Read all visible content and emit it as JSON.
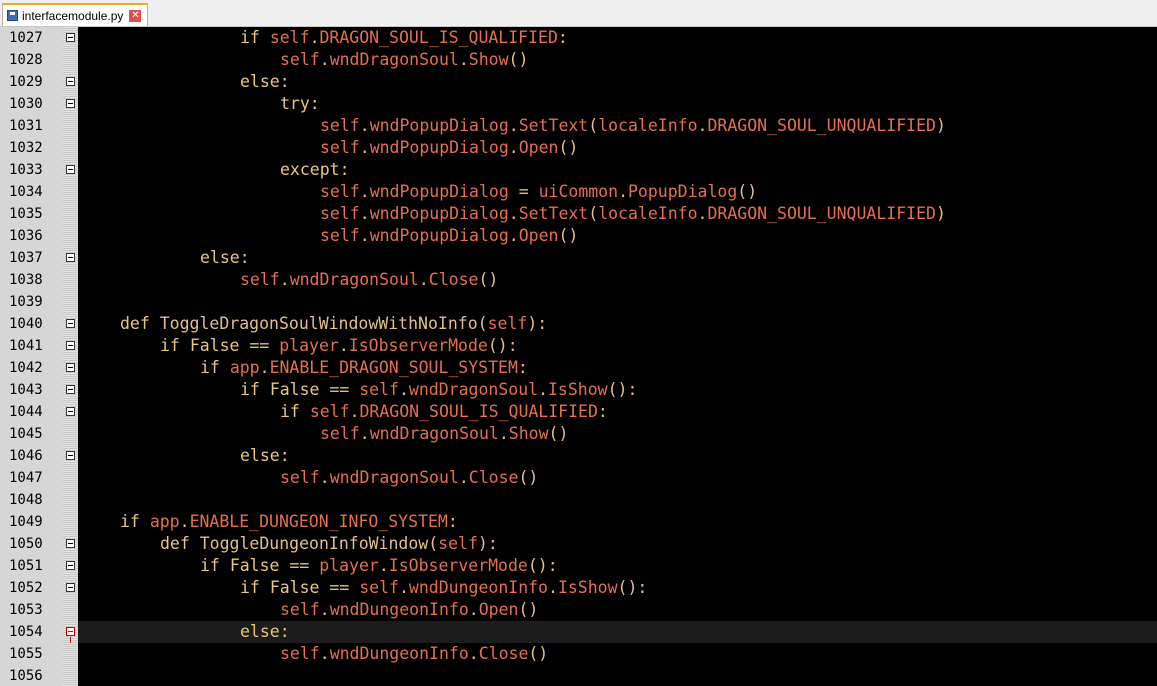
{
  "tab": {
    "title": "interfacemodule.py",
    "close_glyph": "✕"
  },
  "colors": {
    "background": "#000000",
    "gutter": "#d6d6d6",
    "keyword": "#e8c97a",
    "identifier": "#e56f4f",
    "tab_accent": "#f5a623"
  },
  "editor": {
    "current_line": "1054",
    "lines": [
      {
        "n": "1027",
        "fold": "box",
        "indent": 4,
        "tokens": [
          [
            "kw",
            "if "
          ],
          [
            "self",
            "self"
          ],
          [
            "punct",
            "."
          ],
          [
            "attr",
            "DRAGON_SOUL_IS_QUALIFIED"
          ],
          [
            "punct",
            ":"
          ]
        ]
      },
      {
        "n": "1028",
        "fold": "",
        "indent": 5,
        "tokens": [
          [
            "self",
            "self"
          ],
          [
            "punct",
            "."
          ],
          [
            "attr",
            "wndDragonSoul"
          ],
          [
            "punct",
            "."
          ],
          [
            "attr",
            "Show"
          ],
          [
            "punct",
            "()"
          ]
        ]
      },
      {
        "n": "1029",
        "fold": "box",
        "indent": 4,
        "tokens": [
          [
            "kw",
            "else:"
          ]
        ]
      },
      {
        "n": "1030",
        "fold": "box",
        "indent": 5,
        "tokens": [
          [
            "kw",
            "try:"
          ]
        ]
      },
      {
        "n": "1031",
        "fold": "",
        "indent": 6,
        "tokens": [
          [
            "self",
            "self"
          ],
          [
            "punct",
            "."
          ],
          [
            "attr",
            "wndPopupDialog"
          ],
          [
            "punct",
            "."
          ],
          [
            "attr",
            "SetText"
          ],
          [
            "punct",
            "("
          ],
          [
            "attr",
            "localeInfo"
          ],
          [
            "punct",
            "."
          ],
          [
            "attr",
            "DRAGON_SOUL_UNQUALIFIED"
          ],
          [
            "punct",
            ")"
          ]
        ]
      },
      {
        "n": "1032",
        "fold": "",
        "indent": 6,
        "tokens": [
          [
            "self",
            "self"
          ],
          [
            "punct",
            "."
          ],
          [
            "attr",
            "wndPopupDialog"
          ],
          [
            "punct",
            "."
          ],
          [
            "attr",
            "Open"
          ],
          [
            "punct",
            "()"
          ]
        ]
      },
      {
        "n": "1033",
        "fold": "box",
        "indent": 5,
        "tokens": [
          [
            "kw",
            "except:"
          ]
        ]
      },
      {
        "n": "1034",
        "fold": "",
        "indent": 6,
        "tokens": [
          [
            "self",
            "self"
          ],
          [
            "punct",
            "."
          ],
          [
            "attr",
            "wndPopupDialog"
          ],
          [
            "punct",
            " = "
          ],
          [
            "attr",
            "uiCommon"
          ],
          [
            "punct",
            "."
          ],
          [
            "attr",
            "PopupDialog"
          ],
          [
            "punct",
            "()"
          ]
        ]
      },
      {
        "n": "1035",
        "fold": "",
        "indent": 6,
        "tokens": [
          [
            "self",
            "self"
          ],
          [
            "punct",
            "."
          ],
          [
            "attr",
            "wndPopupDialog"
          ],
          [
            "punct",
            "."
          ],
          [
            "attr",
            "SetText"
          ],
          [
            "punct",
            "("
          ],
          [
            "attr",
            "localeInfo"
          ],
          [
            "punct",
            "."
          ],
          [
            "attr",
            "DRAGON_SOUL_UNQUALIFIED"
          ],
          [
            "punct",
            ")"
          ]
        ]
      },
      {
        "n": "1036",
        "fold": "",
        "indent": 6,
        "tokens": [
          [
            "self",
            "self"
          ],
          [
            "punct",
            "."
          ],
          [
            "attr",
            "wndPopupDialog"
          ],
          [
            "punct",
            "."
          ],
          [
            "attr",
            "Open"
          ],
          [
            "punct",
            "()"
          ]
        ]
      },
      {
        "n": "1037",
        "fold": "box",
        "indent": 3,
        "tokens": [
          [
            "kw",
            "else:"
          ]
        ]
      },
      {
        "n": "1038",
        "fold": "",
        "indent": 4,
        "tokens": [
          [
            "self",
            "self"
          ],
          [
            "punct",
            "."
          ],
          [
            "attr",
            "wndDragonSoul"
          ],
          [
            "punct",
            "."
          ],
          [
            "attr",
            "Close"
          ],
          [
            "punct",
            "()"
          ]
        ]
      },
      {
        "n": "1039",
        "fold": "",
        "indent": 0,
        "tokens": []
      },
      {
        "n": "1040",
        "fold": "box",
        "indent": 1,
        "tokens": [
          [
            "kw",
            "def "
          ],
          [
            "plain",
            "ToggleDragonSoulWindowWithNoInfo"
          ],
          [
            "punct",
            "("
          ],
          [
            "self",
            "self"
          ],
          [
            "punct",
            "):"
          ]
        ]
      },
      {
        "n": "1041",
        "fold": "box",
        "indent": 2,
        "tokens": [
          [
            "kw",
            "if "
          ],
          [
            "kw",
            "False"
          ],
          [
            "punct",
            " == "
          ],
          [
            "attr",
            "player"
          ],
          [
            "punct",
            "."
          ],
          [
            "attr",
            "IsObserverMode"
          ],
          [
            "punct",
            "():"
          ]
        ]
      },
      {
        "n": "1042",
        "fold": "box",
        "indent": 3,
        "tokens": [
          [
            "kw",
            "if "
          ],
          [
            "attr",
            "app"
          ],
          [
            "punct",
            "."
          ],
          [
            "attr",
            "ENABLE_DRAGON_SOUL_SYSTEM"
          ],
          [
            "punct",
            ":"
          ]
        ]
      },
      {
        "n": "1043",
        "fold": "box",
        "indent": 4,
        "tokens": [
          [
            "kw",
            "if "
          ],
          [
            "kw",
            "False"
          ],
          [
            "punct",
            " == "
          ],
          [
            "self",
            "self"
          ],
          [
            "punct",
            "."
          ],
          [
            "attr",
            "wndDragonSoul"
          ],
          [
            "punct",
            "."
          ],
          [
            "attr",
            "IsShow"
          ],
          [
            "punct",
            "():"
          ]
        ]
      },
      {
        "n": "1044",
        "fold": "box",
        "indent": 5,
        "tokens": [
          [
            "kw",
            "if "
          ],
          [
            "self",
            "self"
          ],
          [
            "punct",
            "."
          ],
          [
            "attr",
            "DRAGON_SOUL_IS_QUALIFIED"
          ],
          [
            "punct",
            ":"
          ]
        ]
      },
      {
        "n": "1045",
        "fold": "",
        "indent": 6,
        "tokens": [
          [
            "self",
            "self"
          ],
          [
            "punct",
            "."
          ],
          [
            "attr",
            "wndDragonSoul"
          ],
          [
            "punct",
            "."
          ],
          [
            "attr",
            "Show"
          ],
          [
            "punct",
            "()"
          ]
        ]
      },
      {
        "n": "1046",
        "fold": "box",
        "indent": 4,
        "tokens": [
          [
            "kw",
            "else:"
          ]
        ]
      },
      {
        "n": "1047",
        "fold": "",
        "indent": 5,
        "tokens": [
          [
            "self",
            "self"
          ],
          [
            "punct",
            "."
          ],
          [
            "attr",
            "wndDragonSoul"
          ],
          [
            "punct",
            "."
          ],
          [
            "attr",
            "Close"
          ],
          [
            "punct",
            "()"
          ]
        ]
      },
      {
        "n": "1048",
        "fold": "",
        "indent": 0,
        "tokens": []
      },
      {
        "n": "1049",
        "fold": "",
        "indent": 1,
        "tokens": [
          [
            "kw",
            "if "
          ],
          [
            "attr",
            "app"
          ],
          [
            "punct",
            "."
          ],
          [
            "attr",
            "ENABLE_DUNGEON_INFO_SYSTEM"
          ],
          [
            "punct",
            ":"
          ]
        ]
      },
      {
        "n": "1050",
        "fold": "box",
        "indent": 2,
        "tokens": [
          [
            "kw",
            "def "
          ],
          [
            "plain",
            "ToggleDungeonInfoWindow"
          ],
          [
            "punct",
            "("
          ],
          [
            "self",
            "self"
          ],
          [
            "punct",
            "):"
          ]
        ]
      },
      {
        "n": "1051",
        "fold": "box",
        "indent": 3,
        "tokens": [
          [
            "kw",
            "if "
          ],
          [
            "kw",
            "False"
          ],
          [
            "punct",
            " == "
          ],
          [
            "attr",
            "player"
          ],
          [
            "punct",
            "."
          ],
          [
            "attr",
            "IsObserverMode"
          ],
          [
            "punct",
            "():"
          ]
        ]
      },
      {
        "n": "1052",
        "fold": "box",
        "indent": 4,
        "tokens": [
          [
            "kw",
            "if "
          ],
          [
            "kw",
            "False"
          ],
          [
            "punct",
            " == "
          ],
          [
            "self",
            "self"
          ],
          [
            "punct",
            "."
          ],
          [
            "attr",
            "wndDungeonInfo"
          ],
          [
            "punct",
            "."
          ],
          [
            "attr",
            "IsShow"
          ],
          [
            "punct",
            "():"
          ]
        ]
      },
      {
        "n": "1053",
        "fold": "",
        "indent": 5,
        "tokens": [
          [
            "self",
            "self"
          ],
          [
            "punct",
            "."
          ],
          [
            "attr",
            "wndDungeonInfo"
          ],
          [
            "punct",
            "."
          ],
          [
            "attr",
            "Open"
          ],
          [
            "punct",
            "()"
          ]
        ]
      },
      {
        "n": "1054",
        "fold": "red",
        "indent": 4,
        "tokens": [
          [
            "kw",
            "else:"
          ]
        ]
      },
      {
        "n": "1055",
        "fold": "",
        "indent": 5,
        "tokens": [
          [
            "self",
            "self"
          ],
          [
            "punct",
            "."
          ],
          [
            "attr",
            "wndDungeonInfo"
          ],
          [
            "punct",
            "."
          ],
          [
            "attr",
            "Close"
          ],
          [
            "punct",
            "()"
          ]
        ]
      },
      {
        "n": "1056",
        "fold": "",
        "indent": 0,
        "tokens": []
      }
    ]
  }
}
